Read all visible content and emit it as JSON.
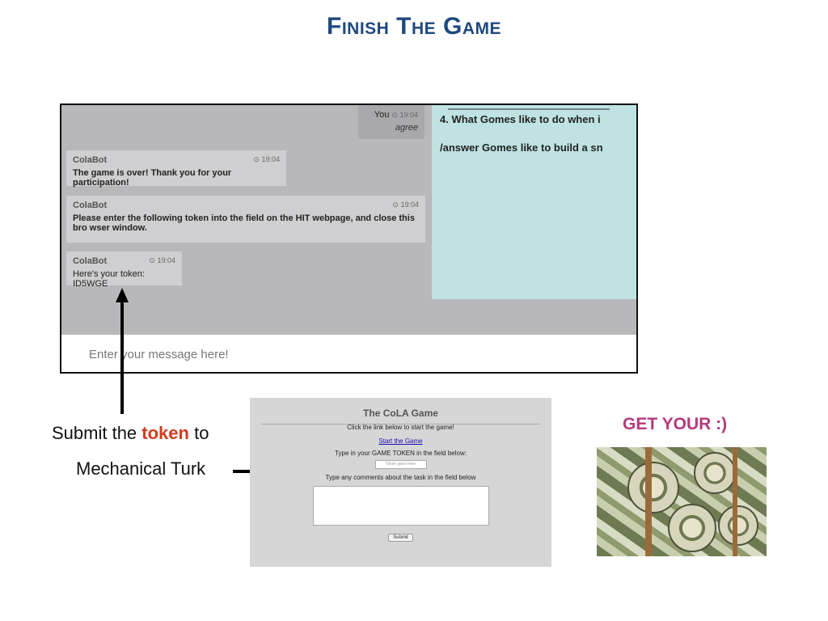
{
  "slide": {
    "title": "Finish The Game"
  },
  "chat": {
    "you_message": {
      "author": "You",
      "time": "19:04",
      "text": "agree"
    },
    "messages": [
      {
        "author": "ColaBot",
        "time": "19:04",
        "text": "The game is over! Thank you for your participation!"
      },
      {
        "author": "ColaBot",
        "time": "19:04",
        "text": "Please enter the following token into the field on the HIT webpage, and close this bro wser window."
      },
      {
        "author": "ColaBot",
        "time": "19:04",
        "text": "Here's your token: ID5WGE"
      }
    ],
    "panel": {
      "question": "4. What Gomes like to do when i",
      "answer": "/answer Gomes like to build a sn"
    },
    "input_placeholder": "Enter your message here!"
  },
  "caption": {
    "line1_prefix": "Submit the ",
    "line1_highlight": "token",
    "line1_suffix": " to",
    "line2": "Mechanical Turk"
  },
  "hit_form": {
    "title": "The CoLA Game",
    "instruction": "Click the link below to start the game!",
    "link": "Start the Game",
    "token_label": "Type in your GAME TOKEN in the field below:",
    "token_placeholder": "Token goes here",
    "comments_label": "Type any comments about the task in the field below",
    "submit": "Submit"
  },
  "reward": {
    "label": "GET YOUR :)"
  },
  "colors": {
    "title": "#1f497d",
    "highlight": "#d23c1e",
    "reward": "#b53a7a",
    "panel": "#bfe2e2"
  }
}
